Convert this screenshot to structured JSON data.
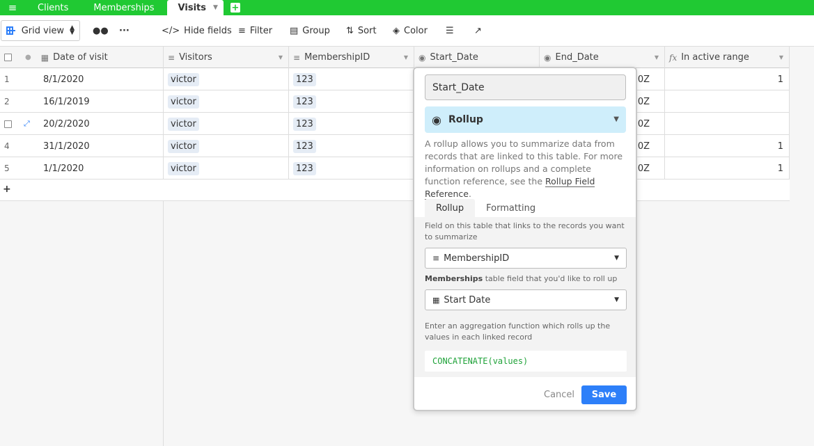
{
  "tabs": {
    "items": [
      "Clients",
      "Memberships",
      "Visits"
    ],
    "active": "Visits"
  },
  "toolbar": {
    "view_label": "Grid view",
    "hide_fields": "Hide fields",
    "filter": "Filter",
    "group": "Group",
    "sort": "Sort",
    "color": "Color"
  },
  "grid": {
    "columns": [
      "Date of visit",
      "Visitors",
      "MembershipID",
      "Start_Date",
      "End_Date",
      "In active range"
    ],
    "rows": [
      {
        "num": "1",
        "date": "8/1/2020",
        "visitor": "victor",
        "membership": "123",
        "end_suffix": "00Z",
        "active": "1"
      },
      {
        "num": "2",
        "date": "16/1/2019",
        "visitor": "victor",
        "membership": "123",
        "end_suffix": "00Z",
        "active": ""
      },
      {
        "num": "",
        "date": "20/2/2020",
        "visitor": "victor",
        "membership": "123",
        "end_suffix": "00Z",
        "active": ""
      },
      {
        "num": "4",
        "date": "31/1/2020",
        "visitor": "victor",
        "membership": "123",
        "end_suffix": "00Z",
        "active": "1"
      },
      {
        "num": "5",
        "date": "1/1/2020",
        "visitor": "victor",
        "membership": "123",
        "end_suffix": "00Z",
        "active": "1"
      }
    ],
    "add_row": "+"
  },
  "popup": {
    "field_name": "Start_Date",
    "field_type": "Rollup",
    "description": "A rollup allows you to summarize data from records that are linked to this table. For more information on rollups and a complete function reference, see the ",
    "link_text": "Rollup Field Reference",
    "desc_end": ".",
    "tabs": [
      "Rollup",
      "Formatting"
    ],
    "link_field_label": "Field on this table that links to the records you want to summarize",
    "link_field_value": "MembershipID",
    "rollup_label_table": "Memberships",
    "rollup_label_rest": " table field that you'd like to roll up",
    "rollup_field_value": "Start Date",
    "agg_label": "Enter an aggregation function which rolls up the values in each linked record",
    "formula": "CONCATENATE(values)",
    "cancel": "Cancel",
    "save": "Save"
  }
}
